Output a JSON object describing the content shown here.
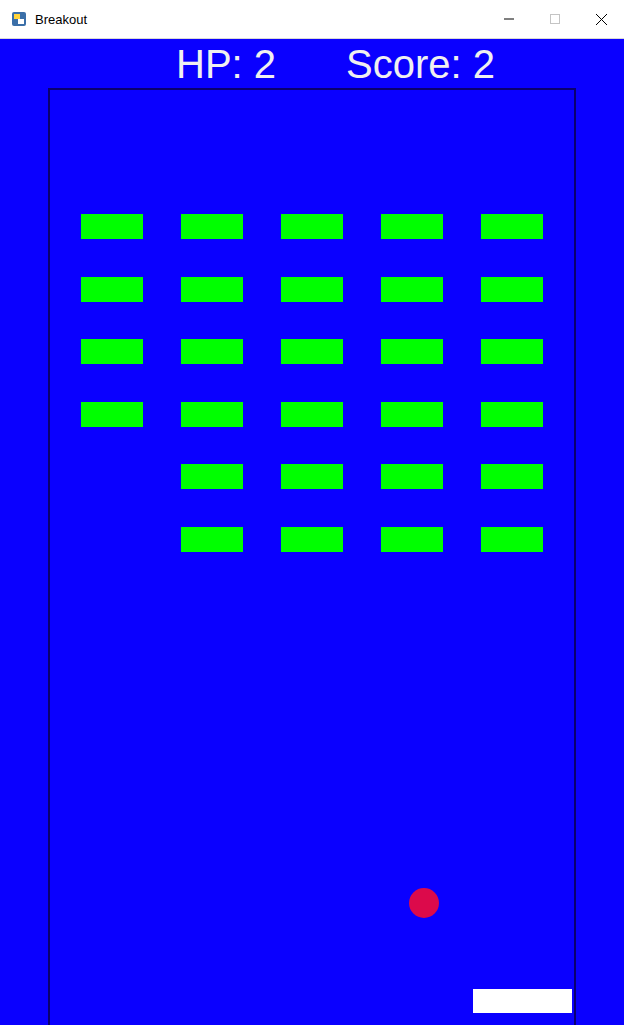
{
  "window": {
    "title": "Breakout",
    "controls": [
      {
        "name": "minimize",
        "disabled": false
      },
      {
        "name": "maximize",
        "disabled": true
      },
      {
        "name": "close",
        "disabled": false
      }
    ]
  },
  "hud": {
    "hp": "HP: 2",
    "score": "Score: 2"
  },
  "bricks": [
    [
      {
        "intact": true
      },
      {
        "intact": true
      },
      {
        "intact": true
      },
      {
        "intact": true
      },
      {
        "intact": true
      }
    ],
    [
      {
        "intact": true
      },
      {
        "intact": true
      },
      {
        "intact": true
      },
      {
        "intact": true
      },
      {
        "intact": true
      }
    ],
    [
      {
        "intact": true
      },
      {
        "intact": true
      },
      {
        "intact": true
      },
      {
        "intact": true
      },
      {
        "intact": true
      }
    ],
    [
      {
        "intact": true
      },
      {
        "intact": true
      },
      {
        "intact": true
      },
      {
        "intact": true
      },
      {
        "intact": true
      }
    ],
    [
      {
        "intact": false
      },
      {
        "intact": true
      },
      {
        "intact": true
      },
      {
        "intact": true
      },
      {
        "intact": true
      }
    ],
    [
      {
        "intact": false
      },
      {
        "intact": true
      },
      {
        "intact": true
      },
      {
        "intact": true
      },
      {
        "intact": true
      }
    ]
  ]
}
